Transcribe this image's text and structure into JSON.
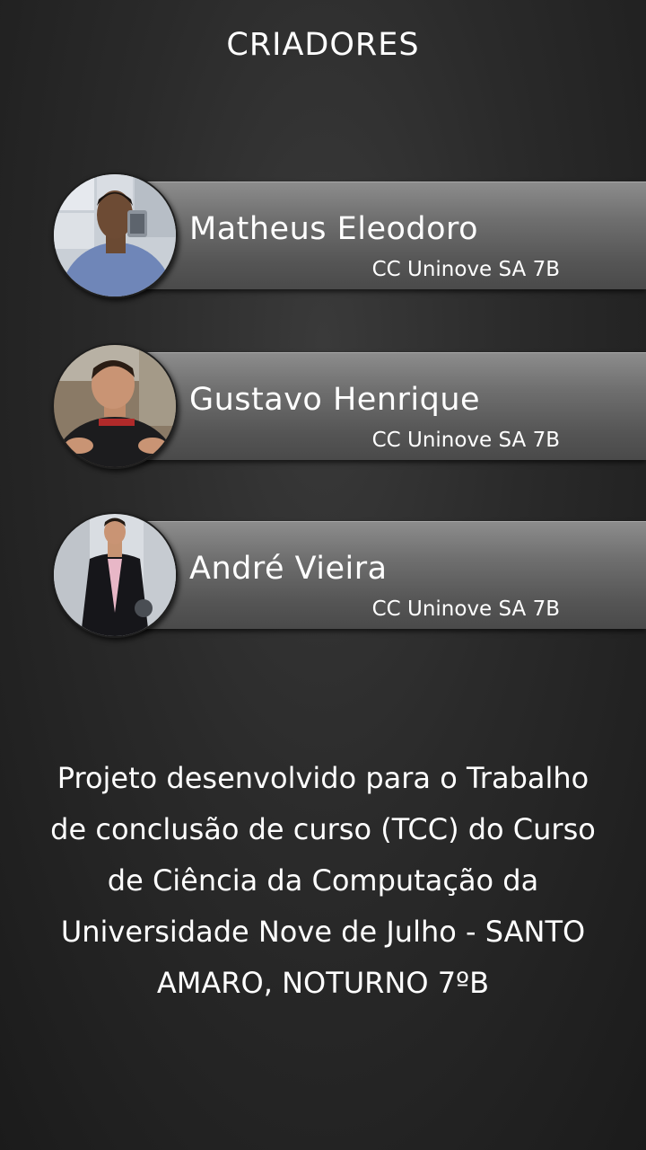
{
  "header": {
    "title": "CRIADORES"
  },
  "creators": [
    {
      "name": "Matheus Eleodoro",
      "subtitle": "CC Uninove SA 7B",
      "avatar_icon": "profile-photo"
    },
    {
      "name": "Gustavo Henrique",
      "subtitle": "CC Uninove SA 7B",
      "avatar_icon": "profile-photo"
    },
    {
      "name": "André Vieira",
      "subtitle": "CC Uninove SA 7B",
      "avatar_icon": "profile-photo"
    }
  ],
  "description": "Projeto desenvolvido para o Trabalho de conclusão de curso (TCC) do Curso de Ciência da Computação da Universidade Nove de Julho - SANTO AMARO, NOTURNO 7ºB"
}
